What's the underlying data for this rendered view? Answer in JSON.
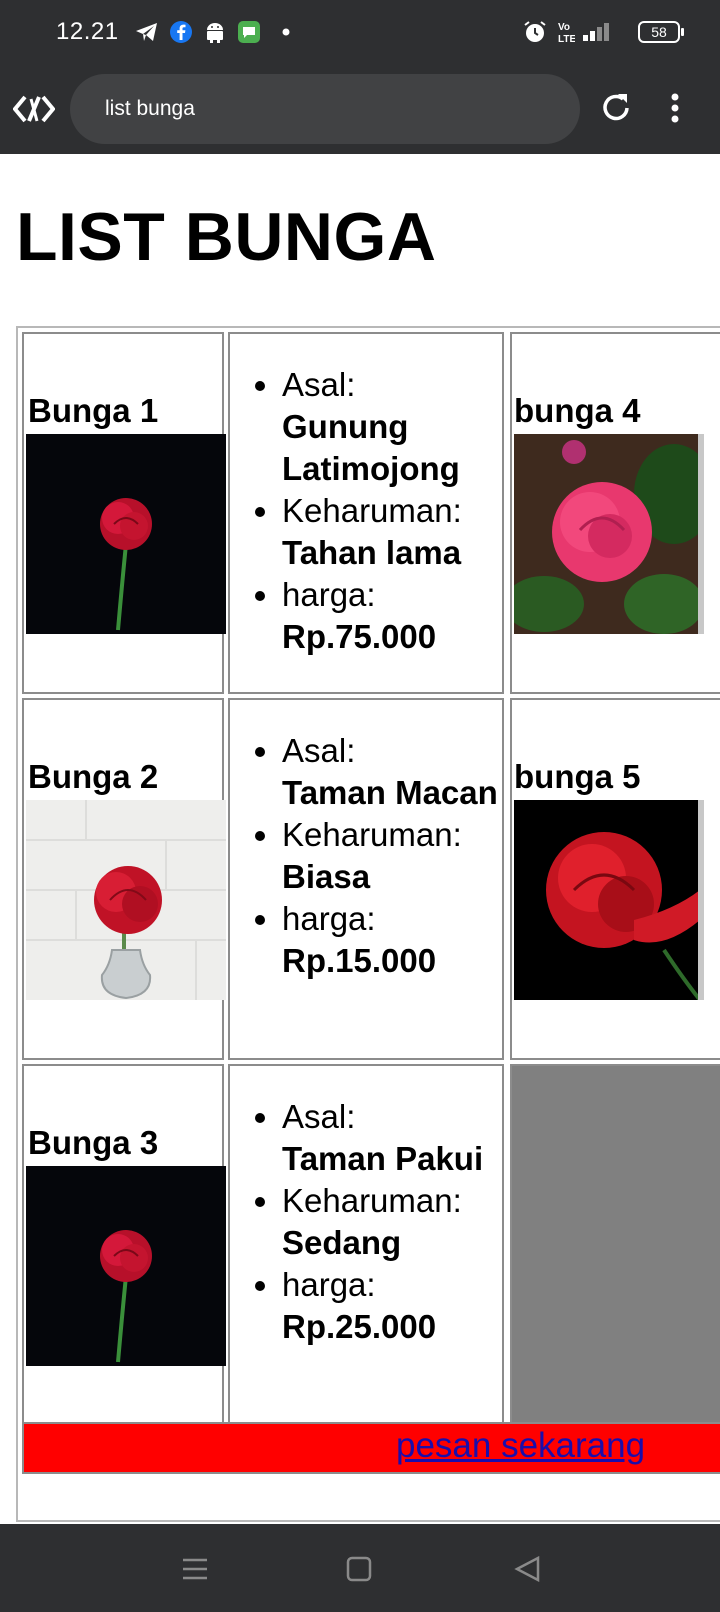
{
  "status": {
    "time": "12.21",
    "battery": "58",
    "icons": [
      "telegram-icon",
      "facebook-icon",
      "android-icon",
      "messages-icon",
      "dot-icon",
      "alarm-icon",
      "volte-icon",
      "signal-icon",
      "battery-icon"
    ]
  },
  "browser": {
    "url_text": "list bunga",
    "icons": [
      "site-icon",
      "reload-icon",
      "more-icon"
    ]
  },
  "page": {
    "heading": "LIST BUNGA",
    "rows": [
      {
        "left_title": "Bunga 1",
        "info": {
          "asal_label": "Asal:",
          "asal_value": "Gunung Latimojong",
          "keharuman_label": "Keharuman:",
          "keharuman_value": "Tahan lama",
          "harga_label": "harga:",
          "harga_value": "Rp.75.000"
        },
        "right_title": "bunga 4"
      },
      {
        "left_title": "Bunga 2",
        "info": {
          "asal_label": "Asal:",
          "asal_value": "Taman Macan",
          "keharuman_label": "Keharuman:",
          "keharuman_value": "Biasa",
          "harga_label": "harga:",
          "harga_value": "Rp.15.000"
        },
        "right_title": "bunga 5"
      },
      {
        "left_title": "Bunga 3",
        "info": {
          "asal_label": "Asal:",
          "asal_value": "Taman Pakui",
          "keharuman_label": "Keharuman:",
          "keharuman_value": "Sedang",
          "harga_label": "harga:",
          "harga_value": "Rp.25.000"
        },
        "right_title": ""
      }
    ],
    "order_link": "pesan sekarang",
    "colors": {
      "order_bg": "#ff0000",
      "empty_cell": "#808080",
      "link": "#1a0dab"
    }
  },
  "navbar": {
    "icons": [
      "menu-icon",
      "home-icon",
      "back-icon"
    ]
  }
}
